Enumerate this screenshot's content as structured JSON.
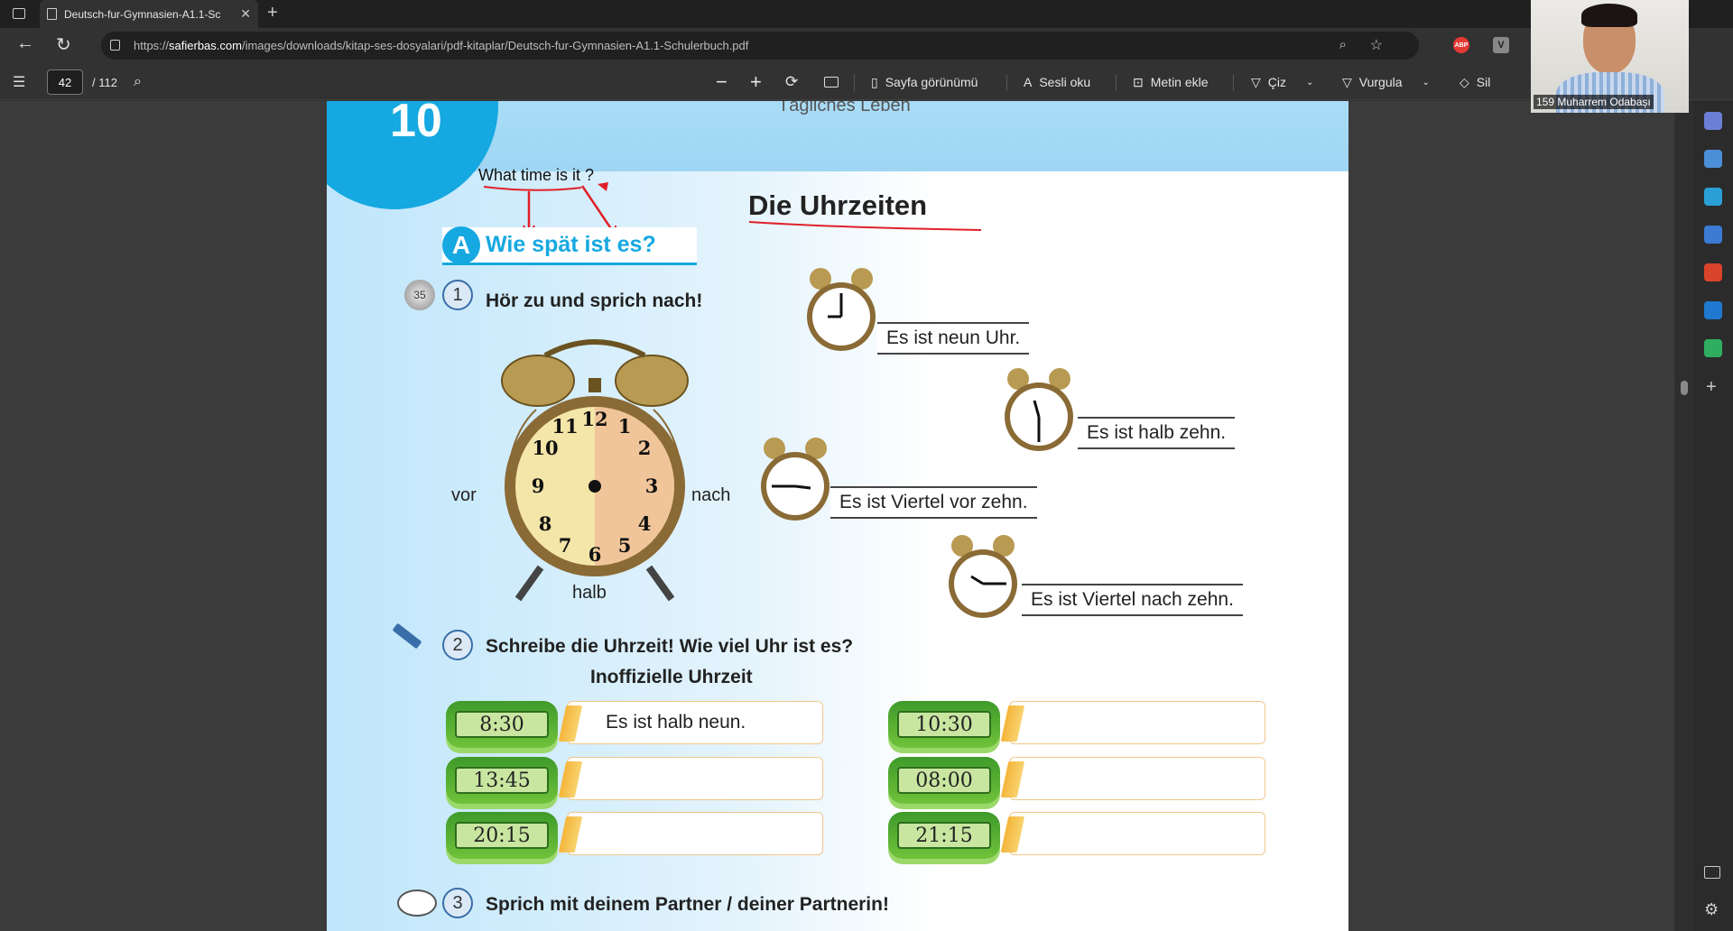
{
  "browser": {
    "tab_title": "Deutsch-fur-Gymnasien-A1.1-Sc",
    "url_prefix": "https://",
    "url_domain": "safierbas.com",
    "url_path": "/images/downloads/kitap-ses-dosyalari/pdf-kitaplar/Deutsch-fur-Gymnasien-A1.1-Schulerbuch.pdf",
    "abp_label": "ABP",
    "v_label": "V"
  },
  "pdf_toolbar": {
    "page_current": "42",
    "page_total": "/ 112",
    "page_view": "Sayfa görünümü",
    "read_aloud": "Sesli oku",
    "add_text": "Metin ekle",
    "draw": "Çiz",
    "highlight": "Vurgula",
    "erase": "Sil"
  },
  "webcam": {
    "participant": "159 Muharrem Odabaşı"
  },
  "page": {
    "unit_number": "10",
    "topic": "Tägliches Leben",
    "title": "Die Uhrzeiten",
    "handwritten_note": "What time is it ?",
    "section_letter": "A",
    "section_title": "Wie spät ist es?",
    "track_number": "35",
    "task1_number": "1",
    "task1_text": "Hör zu und sprich nach!",
    "clock_labels": {
      "left": "vor",
      "right": "nach",
      "bottom": "halb"
    },
    "clock_numbers": [
      "12",
      "1",
      "2",
      "3",
      "4",
      "5",
      "6",
      "7",
      "8",
      "9",
      "10",
      "11"
    ],
    "sentences": [
      "Es ist neun Uhr.",
      "Es ist halb zehn.",
      "Es ist Viertel vor zehn.",
      "Es ist Viertel nach zehn."
    ],
    "task2_number": "2",
    "task2_text": "Schreibe die Uhrzeit! Wie viel Uhr ist es?",
    "task2_sub": "Inoffizielle Uhrzeit",
    "times": [
      {
        "time": "8:30",
        "answer": "Es ist halb neun."
      },
      {
        "time": "10:30",
        "answer": ""
      },
      {
        "time": "13:45",
        "answer": ""
      },
      {
        "time": "08:00",
        "answer": ""
      },
      {
        "time": "20:15",
        "answer": ""
      },
      {
        "time": "21:15",
        "answer": ""
      }
    ],
    "task3_number": "3",
    "task3_text": "Sprich mit deinem Partner / deiner Partnerin!"
  },
  "colors": {
    "accent_blue": "#16a8e0",
    "toolbar_bg": "#323232",
    "lcd_green": "#c9e6a0",
    "red_ink": "#e0202a"
  }
}
